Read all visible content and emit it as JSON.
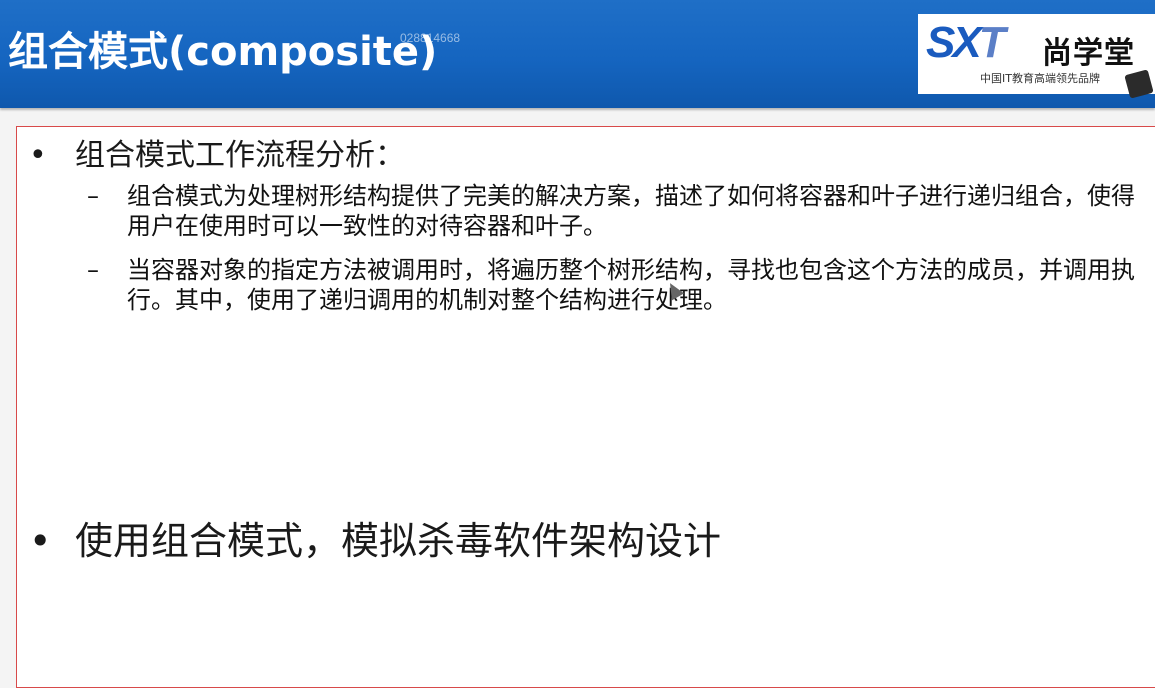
{
  "header": {
    "title": "组合模式(composite)",
    "watermark": "028814668",
    "logo": {
      "mark_left": "SX",
      "mark_right": "T",
      "name": "尚学堂",
      "tagline": "中国IT教育高端领先品牌"
    }
  },
  "slide": {
    "bullets": [
      {
        "bullet": "•",
        "text": "组合模式工作流程分析：",
        "subitems": [
          {
            "dash": "–",
            "text": "组合模式为处理树形结构提供了完美的解决方案，描述了如何将容器和叶子进行递归组合，使得用户在使用时可以一致性的对待容器和叶子。"
          },
          {
            "dash": "–",
            "text": "当容器对象的指定方法被调用时，将遍历整个树形结构，寻找也包含这个方法的成员，并调用执行。其中，使用了递归调用的机制对整个结构进行处理。"
          }
        ]
      },
      {
        "bullet": "•",
        "text": "使用组合模式，模拟杀毒软件架构设计"
      }
    ]
  }
}
